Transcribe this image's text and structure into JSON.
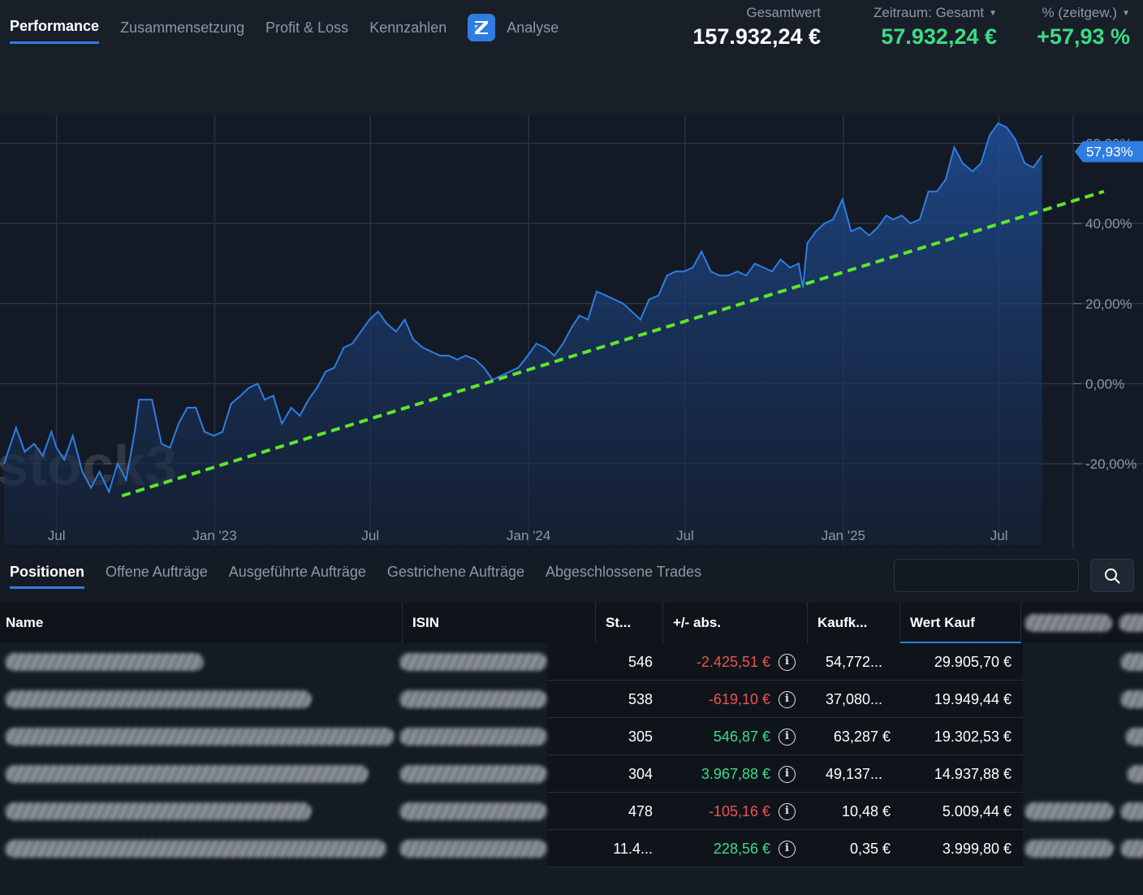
{
  "header": {
    "tabs": [
      {
        "label": "Performance",
        "active": true
      },
      {
        "label": "Zusammensetzung",
        "active": false
      },
      {
        "label": "Profit & Loss",
        "active": false
      },
      {
        "label": "Kennzahlen",
        "active": false
      },
      {
        "label": "Analyse",
        "active": false,
        "icon": "analyse-logo-icon"
      }
    ],
    "stats": {
      "gesamtwert_label": "Gesamtwert",
      "gesamtwert_value": "157.932,24 €",
      "zeitraum_label": "Zeitraum: Gesamt",
      "zeitraum_value": "57.932,24 €",
      "pct_label": "% (zeitgew.)",
      "pct_value": "+57,93 %"
    }
  },
  "chart_data": {
    "type": "area",
    "watermark": "stock3",
    "x_ticks": [
      "Jul",
      "Jan '23",
      "Jul",
      "Jan '24",
      "Jul",
      "Jan '25",
      "Jul"
    ],
    "y_ticks": [
      "60,00%",
      "40,00%",
      "20,00%",
      "0,00%",
      "-20,00%"
    ],
    "y_tick_values": [
      60,
      40,
      20,
      0,
      -20
    ],
    "ylim": [
      -35,
      67
    ],
    "current_value_label": "57,93%",
    "current_value": 57.93,
    "colors": {
      "line": "#2f7de1",
      "trend": "#5ee62b",
      "badge": "#2f7de1"
    },
    "x_start": "2022-05",
    "x_end": "2025-09",
    "x_tick_dates": [
      "2022-07-01",
      "2023-01-01",
      "2023-07-01",
      "2024-01-01",
      "2024-07-01",
      "2025-01-01",
      "2025-07-01"
    ],
    "series": [
      {
        "points": [
          [
            "2022-05-01",
            -20
          ],
          [
            "2022-05-15",
            -11
          ],
          [
            "2022-05-25",
            -17
          ],
          [
            "2022-06-05",
            -15
          ],
          [
            "2022-06-15",
            -18
          ],
          [
            "2022-06-25",
            -12
          ],
          [
            "2022-07-01",
            -16
          ],
          [
            "2022-07-10",
            -19
          ],
          [
            "2022-07-20",
            -13
          ],
          [
            "2022-07-31",
            -22
          ],
          [
            "2022-08-10",
            -26
          ],
          [
            "2022-08-20",
            -22
          ],
          [
            "2022-08-31",
            -27
          ],
          [
            "2022-09-10",
            -20
          ],
          [
            "2022-09-20",
            -24
          ],
          [
            "2022-09-30",
            -12
          ],
          [
            "2022-10-05",
            -4
          ],
          [
            "2022-10-20",
            -4
          ],
          [
            "2022-10-31",
            -15
          ],
          [
            "2022-11-10",
            -16
          ],
          [
            "2022-11-20",
            -10
          ],
          [
            "2022-11-30",
            -6
          ],
          [
            "2022-12-10",
            -6
          ],
          [
            "2022-12-20",
            -12
          ],
          [
            "2022-12-31",
            -13
          ],
          [
            "2023-01-10",
            -12
          ],
          [
            "2023-01-20",
            -5
          ],
          [
            "2023-01-31",
            -3
          ],
          [
            "2023-02-10",
            -1
          ],
          [
            "2023-02-20",
            0
          ],
          [
            "2023-02-28",
            -4
          ],
          [
            "2023-03-10",
            -3
          ],
          [
            "2023-03-20",
            -10
          ],
          [
            "2023-03-31",
            -6
          ],
          [
            "2023-04-10",
            -8
          ],
          [
            "2023-04-20",
            -4
          ],
          [
            "2023-04-30",
            -1
          ],
          [
            "2023-05-10",
            3
          ],
          [
            "2023-05-20",
            4
          ],
          [
            "2023-05-31",
            9
          ],
          [
            "2023-06-10",
            10
          ],
          [
            "2023-06-20",
            13
          ],
          [
            "2023-06-30",
            16
          ],
          [
            "2023-07-10",
            18
          ],
          [
            "2023-07-20",
            15
          ],
          [
            "2023-07-31",
            13
          ],
          [
            "2023-08-10",
            16
          ],
          [
            "2023-08-20",
            11
          ],
          [
            "2023-08-31",
            9
          ],
          [
            "2023-09-10",
            8
          ],
          [
            "2023-09-20",
            7
          ],
          [
            "2023-09-30",
            7
          ],
          [
            "2023-10-10",
            6
          ],
          [
            "2023-10-20",
            7
          ],
          [
            "2023-10-31",
            6
          ],
          [
            "2023-11-10",
            4
          ],
          [
            "2023-11-20",
            1
          ],
          [
            "2023-11-30",
            2
          ],
          [
            "2023-12-10",
            3
          ],
          [
            "2023-12-20",
            4
          ],
          [
            "2023-12-31",
            7
          ],
          [
            "2024-01-10",
            10
          ],
          [
            "2024-01-20",
            9
          ],
          [
            "2024-01-31",
            7
          ],
          [
            "2024-02-10",
            10
          ],
          [
            "2024-02-20",
            14
          ],
          [
            "2024-02-29",
            17
          ],
          [
            "2024-03-10",
            16
          ],
          [
            "2024-03-20",
            23
          ],
          [
            "2024-03-31",
            22
          ],
          [
            "2024-04-10",
            21
          ],
          [
            "2024-04-20",
            20
          ],
          [
            "2024-04-30",
            18
          ],
          [
            "2024-05-10",
            16
          ],
          [
            "2024-05-20",
            21
          ],
          [
            "2024-05-31",
            22
          ],
          [
            "2024-06-10",
            27
          ],
          [
            "2024-06-20",
            28
          ],
          [
            "2024-06-30",
            28
          ],
          [
            "2024-07-10",
            29
          ],
          [
            "2024-07-20",
            33
          ],
          [
            "2024-07-31",
            28
          ],
          [
            "2024-08-10",
            27
          ],
          [
            "2024-08-20",
            27
          ],
          [
            "2024-08-31",
            28
          ],
          [
            "2024-09-10",
            27
          ],
          [
            "2024-09-20",
            30
          ],
          [
            "2024-09-30",
            29
          ],
          [
            "2024-10-10",
            28
          ],
          [
            "2024-10-20",
            31
          ],
          [
            "2024-10-31",
            29
          ],
          [
            "2024-11-10",
            30
          ],
          [
            "2024-11-15",
            24
          ],
          [
            "2024-11-20",
            35
          ],
          [
            "2024-11-30",
            38
          ],
          [
            "2024-12-10",
            40
          ],
          [
            "2024-12-20",
            41
          ],
          [
            "2024-12-31",
            46
          ],
          [
            "2025-01-10",
            38
          ],
          [
            "2025-01-20",
            39
          ],
          [
            "2025-01-31",
            37
          ],
          [
            "2025-02-10",
            39
          ],
          [
            "2025-02-20",
            42
          ],
          [
            "2025-02-28",
            41
          ],
          [
            "2025-03-10",
            42
          ],
          [
            "2025-03-20",
            40
          ],
          [
            "2025-03-31",
            41
          ],
          [
            "2025-04-10",
            48
          ],
          [
            "2025-04-20",
            48
          ],
          [
            "2025-04-30",
            51
          ],
          [
            "2025-05-10",
            59
          ],
          [
            "2025-05-20",
            55
          ],
          [
            "2025-05-31",
            53
          ],
          [
            "2025-06-10",
            55
          ],
          [
            "2025-06-20",
            62
          ],
          [
            "2025-06-30",
            65
          ],
          [
            "2025-07-10",
            64
          ],
          [
            "2025-07-20",
            61
          ],
          [
            "2025-07-31",
            55
          ],
          [
            "2025-08-10",
            54
          ],
          [
            "2025-08-20",
            57
          ]
        ]
      }
    ],
    "trend_line": [
      [
        "2022-09-15",
        -28
      ],
      [
        "2025-10-31",
        48
      ]
    ]
  },
  "bottom_tabs": [
    {
      "label": "Positionen",
      "active": true
    },
    {
      "label": "Offene Aufträge",
      "active": false
    },
    {
      "label": "Ausgeführte Aufträge",
      "active": false
    },
    {
      "label": "Gestrichene Aufträge",
      "active": false
    },
    {
      "label": "Abgeschlossene Trades",
      "active": false
    }
  ],
  "search": {
    "placeholder": "",
    "icon": "search-icon"
  },
  "table": {
    "columns": [
      "Name",
      "ISIN",
      "St...",
      "+/- abs.",
      "Kaufk...",
      "Wert Kauf"
    ],
    "sorted_column": "Wert Kauf",
    "rows": [
      {
        "stueck": "546",
        "abs": "-2.425,51 €",
        "sign": "neg",
        "kaufkurs": "54,772...",
        "wert_kauf": "29.905,70 €"
      },
      {
        "stueck": "538",
        "abs": "-619,10 €",
        "sign": "neg",
        "kaufkurs": "37,080...",
        "wert_kauf": "19.949,44 €"
      },
      {
        "stueck": "305",
        "abs": "546,87 €",
        "sign": "pos",
        "kaufkurs": "63,287 €",
        "wert_kauf": "19.302,53 €"
      },
      {
        "stueck": "304",
        "abs": "3.967,88 €",
        "sign": "pos",
        "kaufkurs": "49,137...",
        "wert_kauf": "14.937,88 €"
      },
      {
        "stueck": "478",
        "abs": "-105,16 €",
        "sign": "neg",
        "kaufkurs": "10,48 €",
        "wert_kauf": "5.009,44 €"
      },
      {
        "stueck": "11.4...",
        "abs": "228,56 €",
        "sign": "pos",
        "kaufkurs": "0,35 €",
        "wert_kauf": "3.999,80 €"
      }
    ]
  }
}
